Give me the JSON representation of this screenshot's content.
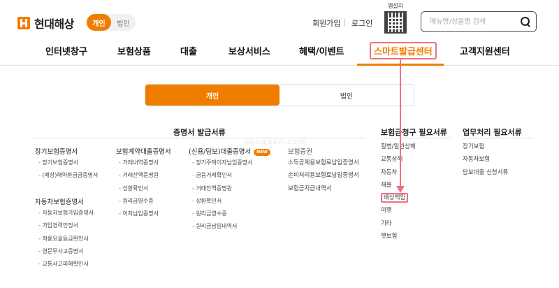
{
  "header": {
    "logo_text": "현대해상",
    "segment": {
      "personal": "개인",
      "corporate": "법인"
    },
    "signup": "회원가입",
    "login": "로그인",
    "app_install": "앱설치",
    "search_placeholder": "메뉴명/상품명 검색"
  },
  "nav": {
    "items": [
      "인터넷창구",
      "보험상품",
      "대출",
      "보상서비스",
      "혜택/이벤트",
      "스마트발급센터",
      "고객지원센터"
    ],
    "active": "스마트발급센터"
  },
  "main_toggle": {
    "personal": "개인",
    "corporate": "법인"
  },
  "watermark": "ooowoon.com",
  "sections": {
    "certificates": {
      "title": "증명서 발급서류",
      "columns": [
        {
          "head": "장기보험증명서",
          "items": [
            "장기보험증명서",
            "(예상)해약환급금증명서"
          ]
        },
        {
          "head": "자동차보험증명서",
          "items": [
            "자동차보험가입증명서",
            "가입경력인정서",
            "적용요율등급확인서",
            "영문무사고증명서",
            "교통사고피해확인서"
          ]
        },
        {
          "head": "보험계약대출증명서",
          "items": [
            "거래내역증명서",
            "거래잔액증명원",
            "상환확인서",
            "원리금영수증",
            "이자납입증명서"
          ]
        },
        {
          "head": "(신용/담보)대출증명서",
          "badge": "NEW",
          "items": [
            "장기주택이자납입증명서",
            "금융거래확인서",
            "거래잔액증명원",
            "상환확인서",
            "원리금영수증",
            "원리금납입내역서"
          ]
        },
        {
          "head": "보험증권",
          "items": [
            "소득공제용보험료납입증명서",
            "손비처리용보험료납입증명서",
            "보험금지급내역서"
          ]
        }
      ]
    },
    "claim": {
      "title": "보험금청구 필요서류",
      "items": [
        "질병/일반상해",
        "교통상해",
        "자동차",
        "재물",
        "배상책임",
        "여행",
        "기타",
        "펫보험"
      ],
      "highlighted": "배상책임"
    },
    "business": {
      "title": "업무처리 필요서류",
      "items": [
        "장기보험",
        "자동차보험",
        "담보대출 신청서류"
      ]
    }
  },
  "colors": {
    "accent": "#f07d00",
    "highlight": "#f07080"
  }
}
